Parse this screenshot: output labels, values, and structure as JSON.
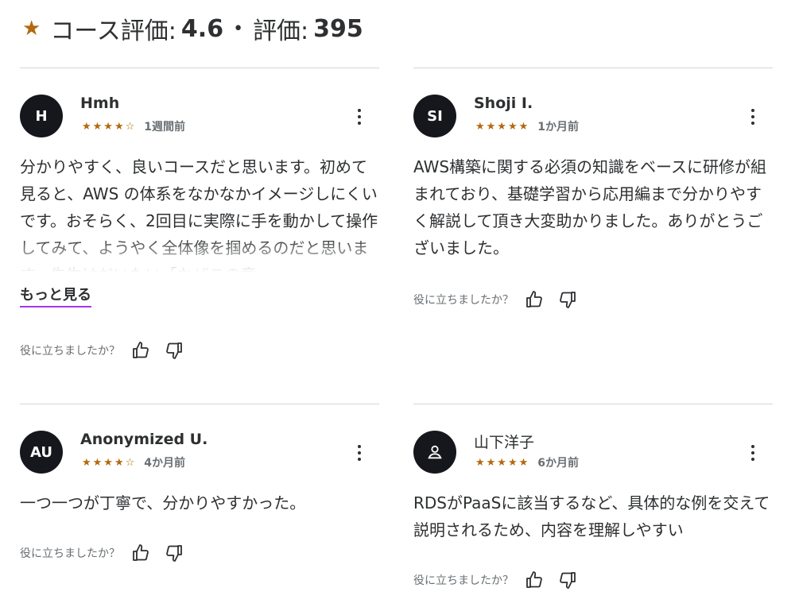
{
  "header": {
    "course_rating_label": "コース評価:",
    "course_rating": "4.6",
    "separator": "•",
    "rating_count_label": "評価:",
    "rating_count": "395"
  },
  "helpful_label": "役に立ちましたか？",
  "icons": {
    "header_star": "star-icon",
    "more": "more-options-icon",
    "thumb_up": "thumbs-up-icon",
    "thumb_down": "thumbs-down-icon",
    "default_avatar": "user-icon"
  },
  "colors": {
    "star": "#b4690e",
    "avatar_bg": "#16161d",
    "link_underline": "#a435f0",
    "divider": "#d1d7dc"
  },
  "reviews": [
    {
      "initials": "H",
      "name": "Hmh",
      "stars": "★★★★☆",
      "rating": 4,
      "date": "1週間前",
      "text": "分かりやすく、良いコースだと思います。初めて見ると、AWS の体系をなかなかイメージしにくいです。おそらく、2回目に実際に手を動かして操作してみて、ようやく全体像を掴めるのだと思います。先生はだいたい「なぜこの章",
      "show_more": "もっと見る"
    },
    {
      "initials": "SI",
      "name": "Shoji I.",
      "stars": "★★★★★",
      "rating": 5,
      "date": "1か月前",
      "text": "AWS構築に関する必須の知識をベースに研修が組まれており、基礎学習から応用編まで分かりやすく解説して頂き大変助かりました。ありがとうございました。"
    },
    {
      "initials": "AU",
      "name": "Anonymized U.",
      "stars": "★★★★☆",
      "rating": 4,
      "date": "4か月前",
      "text": "一つ一つが丁寧で、分かりやすかった。"
    },
    {
      "initials": "",
      "name": "山下洋子",
      "stars": "★★★★★",
      "rating": 5,
      "date": "6か月前",
      "text": "RDSがPaaSに該当するなど、具体的な例を交えて説明されるため、内容を理解しやすい"
    }
  ]
}
